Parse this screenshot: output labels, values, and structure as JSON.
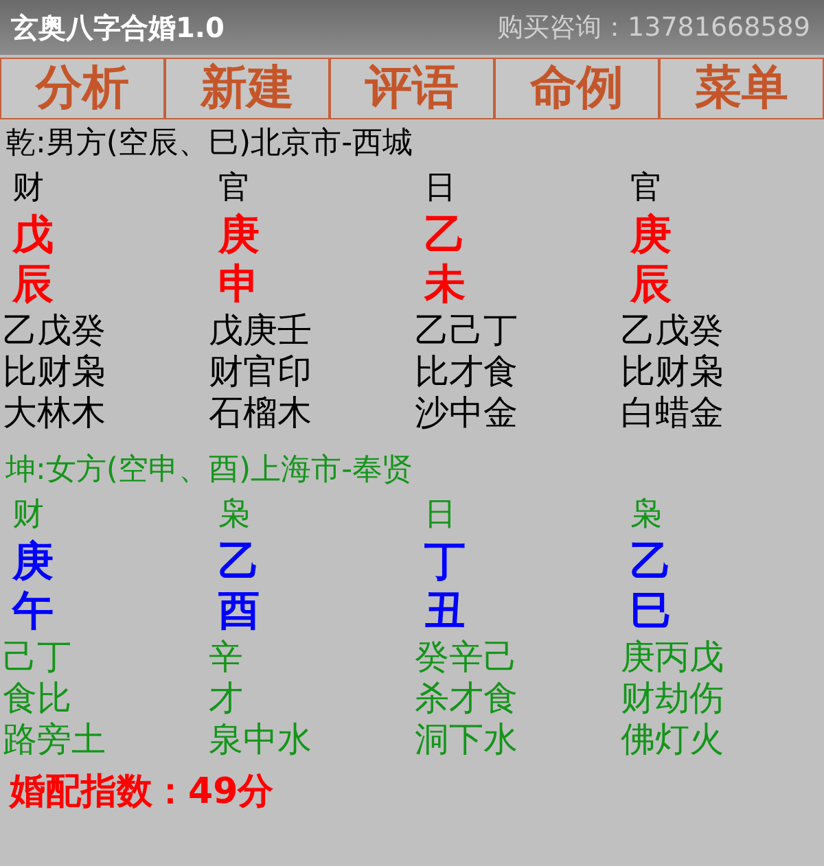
{
  "title_bar": {
    "title": "玄奥八字合婚1.0",
    "contact": "购买咨询：13781668589"
  },
  "menu": [
    "分析",
    "新建",
    "评语",
    "命例",
    "菜单"
  ],
  "charts": [
    {
      "kind": "male",
      "header": "乾:男方(空辰、巳)北京市-西城",
      "pillars": [
        {
          "ten_god": "财",
          "stem": "戊",
          "branch": "辰",
          "hidden_stems": "乙戊癸",
          "hidden_gods": "比财枭",
          "nayin": "大林木"
        },
        {
          "ten_god": "官",
          "stem": "庚",
          "branch": "申",
          "hidden_stems": "戊庚壬",
          "hidden_gods": "财官印",
          "nayin": "石榴木"
        },
        {
          "ten_god": "日",
          "stem": "乙",
          "branch": "未",
          "hidden_stems": "乙己丁",
          "hidden_gods": "比才食",
          "nayin": "沙中金"
        },
        {
          "ten_god": "官",
          "stem": "庚",
          "branch": "辰",
          "hidden_stems": "乙戊癸",
          "hidden_gods": "比财枭",
          "nayin": "白蜡金"
        }
      ]
    },
    {
      "kind": "female",
      "header": "坤:女方(空申、酉)上海市-奉贤",
      "pillars": [
        {
          "ten_god": "财",
          "stem": "庚",
          "branch": "午",
          "hidden_stems": "己丁",
          "hidden_gods": "食比",
          "nayin": "路旁土"
        },
        {
          "ten_god": "枭",
          "stem": "乙",
          "branch": "酉",
          "hidden_stems": "辛",
          "hidden_gods": "才",
          "nayin": "泉中水"
        },
        {
          "ten_god": "日",
          "stem": "丁",
          "branch": "丑",
          "hidden_stems": "癸辛己",
          "hidden_gods": "杀才食",
          "nayin": "洞下水"
        },
        {
          "ten_god": "枭",
          "stem": "乙",
          "branch": "巳",
          "hidden_stems": "庚丙戊",
          "hidden_gods": "财劫伤",
          "nayin": "佛灯火"
        }
      ]
    }
  ],
  "score": "婚配指数：49分"
}
